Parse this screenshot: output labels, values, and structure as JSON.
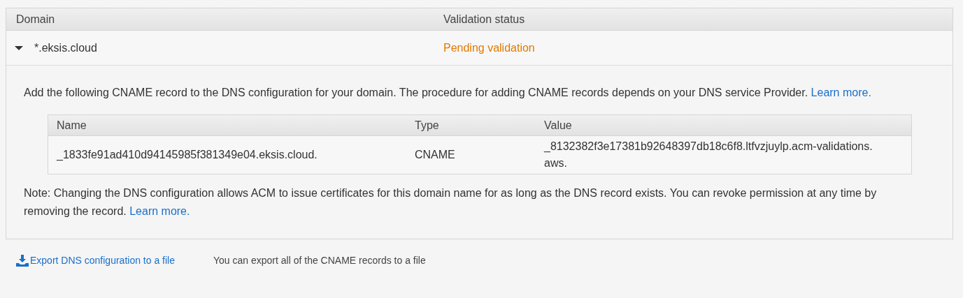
{
  "table": {
    "columns": [
      "Domain",
      "Validation status"
    ],
    "rows": [
      {
        "domain": "*.eksis.cloud",
        "status": "Pending validation",
        "expanded": true,
        "details": {
          "intro": "Add the following CNAME record to the DNS configuration for your domain. The procedure for adding CNAME records depends on your DNS service Provider.",
          "intro_link": "Learn more.",
          "record_table": {
            "columns": [
              "Name",
              "Type",
              "Value"
            ],
            "rows": [
              [
                "_1833fe91ad410d94145985f381349e04.eksis.cloud.",
                "CNAME",
                "_8132382f3e17381b92648397db18c6f8.ltfvzjuylp.acm-validations.aws."
              ]
            ]
          },
          "note": "Note: Changing the DNS configuration allows ACM to issue certificates for this domain name for as long as the DNS record exists. You can revoke permission at any time by removing the record.",
          "note_link": "Learn more."
        }
      }
    ]
  },
  "export": {
    "link": "Export DNS configuration to a file",
    "hint": "You can export all of the CNAME records to a file"
  }
}
